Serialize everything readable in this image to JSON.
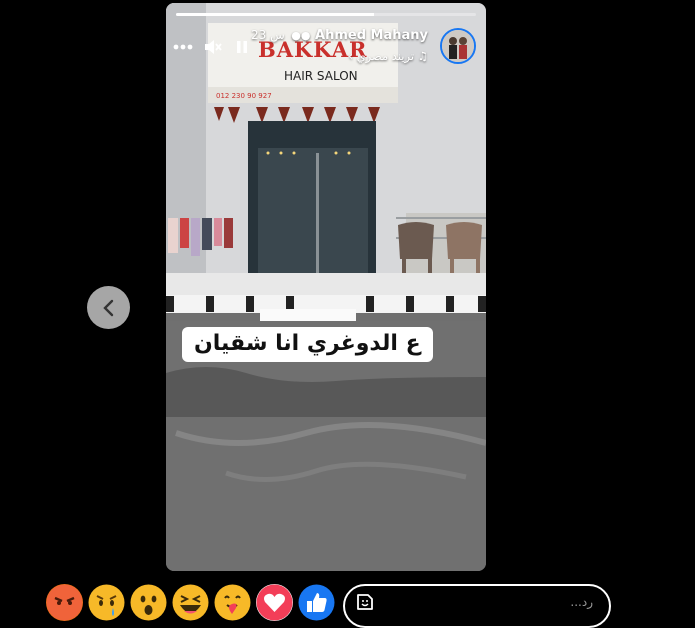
{
  "story": {
    "progress_fraction": 0.66,
    "author_name": "Ahmed Mahany",
    "time_ago": "23 س",
    "music_label": "تريند مصري",
    "caption": "ع الدوغري انا شقيان",
    "sign": {
      "brand": "BAKKAR",
      "subtitle": "HAIR SALON",
      "phone": "012 230 90 927"
    }
  },
  "reply": {
    "placeholder": "رد..."
  },
  "reactions": [
    "angry",
    "sad",
    "wow",
    "haha",
    "care",
    "love",
    "like"
  ],
  "colors": {
    "like": "#1877f2",
    "love": "#f33e58",
    "emoji_yellow": "#f7b928",
    "angry": "#e9710f"
  }
}
